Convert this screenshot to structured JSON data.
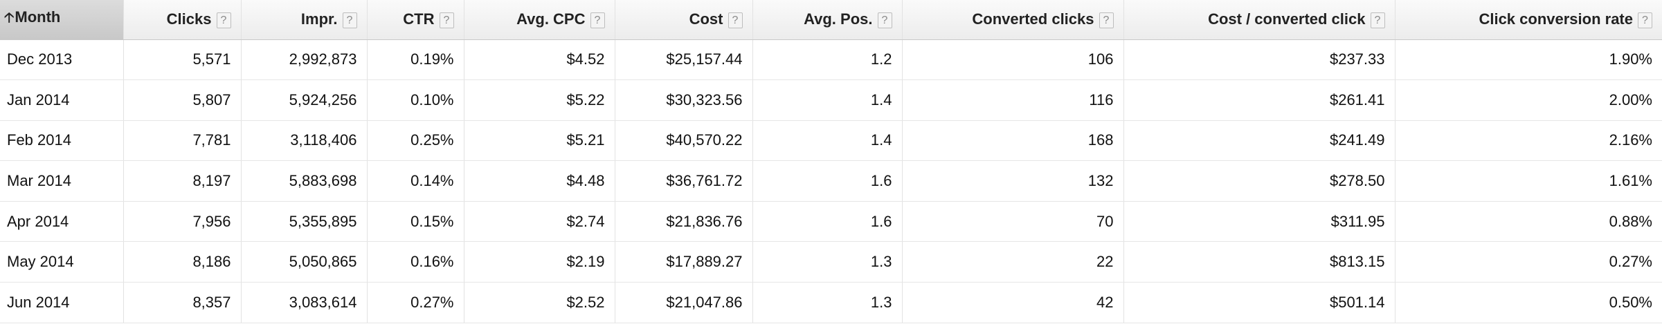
{
  "columns": [
    {
      "label": "Month",
      "sorted": true,
      "sort_icon": "sort-ascending-icon"
    },
    {
      "label": "Clicks",
      "help": "?"
    },
    {
      "label": "Impr.",
      "help": "?"
    },
    {
      "label": "CTR",
      "help": "?"
    },
    {
      "label": "Avg. CPC",
      "help": "?"
    },
    {
      "label": "Cost",
      "help": "?"
    },
    {
      "label": "Avg. Pos.",
      "help": "?"
    },
    {
      "label": "Converted clicks",
      "help": "?"
    },
    {
      "label": "Cost / converted click",
      "help": "?"
    },
    {
      "label": "Click conversion rate",
      "help": "?"
    }
  ],
  "rows": [
    [
      "Dec 2013",
      "5,571",
      "2,992,873",
      "0.19%",
      "$4.52",
      "$25,157.44",
      "1.2",
      "106",
      "$237.33",
      "1.90%"
    ],
    [
      "Jan 2014",
      "5,807",
      "5,924,256",
      "0.10%",
      "$5.22",
      "$30,323.56",
      "1.4",
      "116",
      "$261.41",
      "2.00%"
    ],
    [
      "Feb 2014",
      "7,781",
      "3,118,406",
      "0.25%",
      "$5.21",
      "$40,570.22",
      "1.4",
      "168",
      "$241.49",
      "2.16%"
    ],
    [
      "Mar 2014",
      "8,197",
      "5,883,698",
      "0.14%",
      "$4.48",
      "$36,761.72",
      "1.6",
      "132",
      "$278.50",
      "1.61%"
    ],
    [
      "Apr 2014",
      "7,956",
      "5,355,895",
      "0.15%",
      "$2.74",
      "$21,836.76",
      "1.6",
      "70",
      "$311.95",
      "0.88%"
    ],
    [
      "May 2014",
      "8,186",
      "5,050,865",
      "0.16%",
      "$2.19",
      "$17,889.27",
      "1.3",
      "22",
      "$813.15",
      "0.27%"
    ],
    [
      "Jun 2014",
      "8,357",
      "3,083,614",
      "0.27%",
      "$2.52",
      "$21,047.86",
      "1.3",
      "42",
      "$501.14",
      "0.50%"
    ]
  ]
}
